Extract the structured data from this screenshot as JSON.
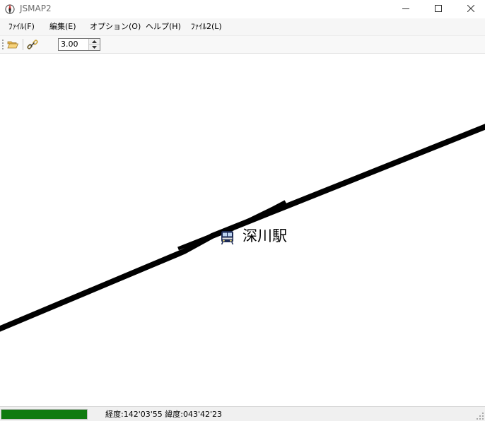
{
  "window": {
    "title": "JSMAP2",
    "icon": "compass-app-icon"
  },
  "window_controls": {
    "minimize_icon": "minimize-icon",
    "maximize_icon": "maximize-icon",
    "close_icon": "close-icon"
  },
  "menu": {
    "items": [
      {
        "label": "ﾌｧｲﾙ(F)"
      },
      {
        "label": "編集(E)"
      },
      {
        "label": "オプション(O)"
      },
      {
        "label": "ヘルプ(H)"
      },
      {
        "label": "ﾌｧｲﾙ2(L)"
      }
    ]
  },
  "toolbar": {
    "open_icon": "folder-open-icon",
    "link_icon": "link-icon",
    "scale_value": "3.00"
  },
  "map": {
    "station_name": "深川駅",
    "station_icon": "train-icon",
    "line_color": "#000000"
  },
  "status": {
    "progress": 1.0,
    "progress_color": "#0f7b0f",
    "coordinates": "経度:142'03'55 緯度:043'42'23"
  }
}
